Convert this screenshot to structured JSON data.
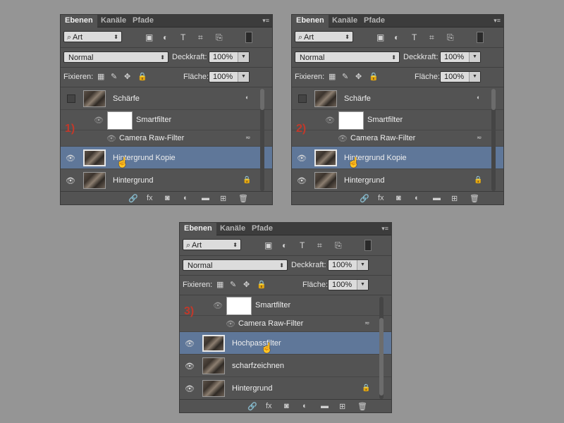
{
  "tabs": [
    "Ebenen",
    "Kanäle",
    "Pfade"
  ],
  "filter": {
    "label": "Art"
  },
  "blend_mode": "Normal",
  "opacity": {
    "label": "Deckkraft:",
    "value": "100%"
  },
  "lock": {
    "label": "Fixieren:"
  },
  "fill": {
    "label": "Fläche:",
    "value": "100%"
  },
  "panels": [
    {
      "step": "1)",
      "layers": [
        {
          "name": "Schärfe",
          "type": "group",
          "visible": false
        },
        {
          "name": "Smartfilter",
          "type": "smartfilter"
        },
        {
          "name": "Camera Raw-Filter",
          "type": "filter"
        },
        {
          "name": "Hintergrund Kopie",
          "type": "layer",
          "selected": true
        },
        {
          "name": "Hintergrund",
          "type": "layer",
          "locked": true
        }
      ]
    },
    {
      "step": "2)",
      "layers": [
        {
          "name": "Schärfe",
          "type": "group",
          "visible": false
        },
        {
          "name": "Smartfilter",
          "type": "smartfilter"
        },
        {
          "name": "Camera Raw-Filter",
          "type": "filter"
        },
        {
          "name": "Hintergrund Kopie",
          "type": "layer",
          "selected": true
        },
        {
          "name": "Hintergrund",
          "type": "layer",
          "locked": true
        }
      ]
    },
    {
      "step": "3)",
      "layers": [
        {
          "name": "Smartfilter",
          "type": "smartfilter"
        },
        {
          "name": "Camera Raw-Filter",
          "type": "filter"
        },
        {
          "name": "Hochpassfilter",
          "type": "layer",
          "selected": true
        },
        {
          "name": "scharfzeichnen",
          "type": "layer"
        },
        {
          "name": "Hintergrund",
          "type": "layer",
          "locked": true
        }
      ]
    }
  ],
  "footer_icons": [
    "link-icon",
    "fx-icon",
    "mask-icon",
    "adjustment-icon",
    "folder-icon",
    "new-layer-icon",
    "trash-icon"
  ],
  "fx_label": "fx"
}
